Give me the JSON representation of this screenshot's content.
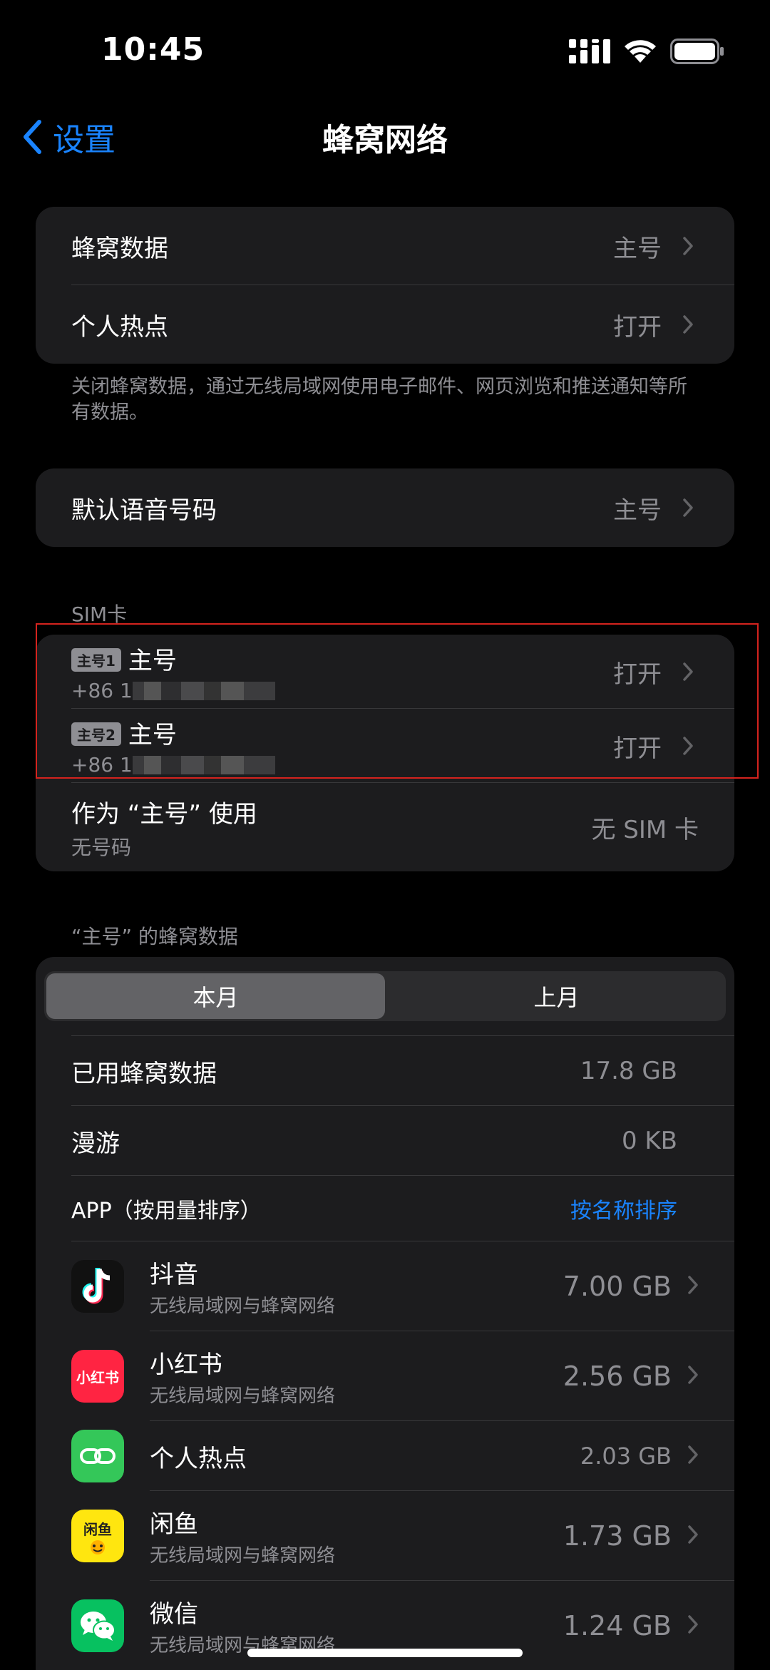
{
  "status_bar": {
    "time": "10:45",
    "icons": [
      "signal-icon",
      "wifi-icon",
      "battery-icon"
    ]
  },
  "nav": {
    "back_label": "设置",
    "title": "蜂窝网络"
  },
  "group1": {
    "rows": [
      {
        "label": "蜂窝数据",
        "value": "主号"
      },
      {
        "label": "个人热点",
        "value": "打开"
      }
    ],
    "footnote": "关闭蜂窝数据，通过无线局域网使用电子邮件、网页浏览和推送通知等所有数据。"
  },
  "group2": {
    "label": "默认语音号码",
    "value": "主号"
  },
  "sim": {
    "header": "SIM卡",
    "cards": [
      {
        "tag": "主号1",
        "name": "主号",
        "number": "+86 1",
        "status": "打开"
      },
      {
        "tag": "主号2",
        "name": "主号",
        "number": "+86 1",
        "status": "打开"
      }
    ],
    "use_as": {
      "label": "作为 “主号” 使用",
      "sub": "无号码",
      "value": "无 SIM 卡"
    }
  },
  "usage": {
    "header": "“主号” 的蜂窝数据",
    "tabs": [
      "本月",
      "上月"
    ],
    "active_tab": "本月",
    "used": {
      "label": "已用蜂窝数据",
      "value": "17.8 GB"
    },
    "roaming": {
      "label": "漫游",
      "value": "0 KB"
    },
    "apps_header": {
      "label": "APP（按用量排序）",
      "sort_link": "按名称排序"
    },
    "apps": [
      {
        "name": "抖音",
        "sub": "无线局域网与蜂窝网络",
        "size": "7.00 GB",
        "icon": "douyin-icon"
      },
      {
        "name": "小红书",
        "sub": "无线局域网与蜂窝网络",
        "size": "2.56 GB",
        "icon": "xiaohongshu-icon",
        "icon_text": "小红书"
      },
      {
        "name": "个人热点",
        "sub": "",
        "size": "2.03 GB",
        "icon": "hotspot-icon"
      },
      {
        "name": "闲鱼",
        "sub": "无线局域网与蜂窝网络",
        "size": "1.73 GB",
        "icon": "xianyu-icon",
        "icon_text": "闲鱼"
      },
      {
        "name": "微信",
        "sub": "无线局域网与蜂窝网络",
        "size": "1.24 GB",
        "icon": "wechat-icon"
      }
    ]
  },
  "colors": {
    "accent": "#1a84ff",
    "background": "#000000",
    "cell": "#1c1c1e",
    "secondary_text": "#8e8e93",
    "highlight_box": "#d4231e"
  }
}
